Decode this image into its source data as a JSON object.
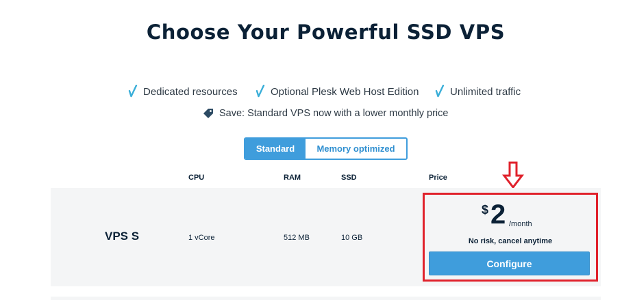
{
  "page": {
    "title": "Choose Your Powerful SSD VPS"
  },
  "features": [
    {
      "label": "Dedicated resources",
      "icon": "check-icon"
    },
    {
      "label": "Optional Plesk Web Host Edition",
      "icon": "check-icon"
    },
    {
      "label": "Unlimited traffic",
      "icon": "check-icon"
    }
  ],
  "promo": {
    "icon": "price-tag-icon",
    "text": "Save: Standard VPS now with a lower monthly price"
  },
  "toggle": {
    "options": [
      "Standard",
      "Memory optimized"
    ],
    "selected": "Standard"
  },
  "table": {
    "columns": {
      "cpu": "CPU",
      "ram": "RAM",
      "ssd": "SSD",
      "price": "Price"
    },
    "rows": [
      {
        "name": "VPS S",
        "cpu": "1 vCore",
        "ram": "512 MB",
        "ssd": "10 GB",
        "currency": "$",
        "price": "2",
        "period": "/month",
        "note": "No risk, cancel anytime",
        "cta": "Configure"
      }
    ]
  },
  "annotation": {
    "arrow": "arrow-down-icon",
    "highlight_color": "#e0212b"
  },
  "colors": {
    "accent": "#3f9ddc",
    "text": "#0b2136",
    "row_bg": "#f4f5f6"
  }
}
